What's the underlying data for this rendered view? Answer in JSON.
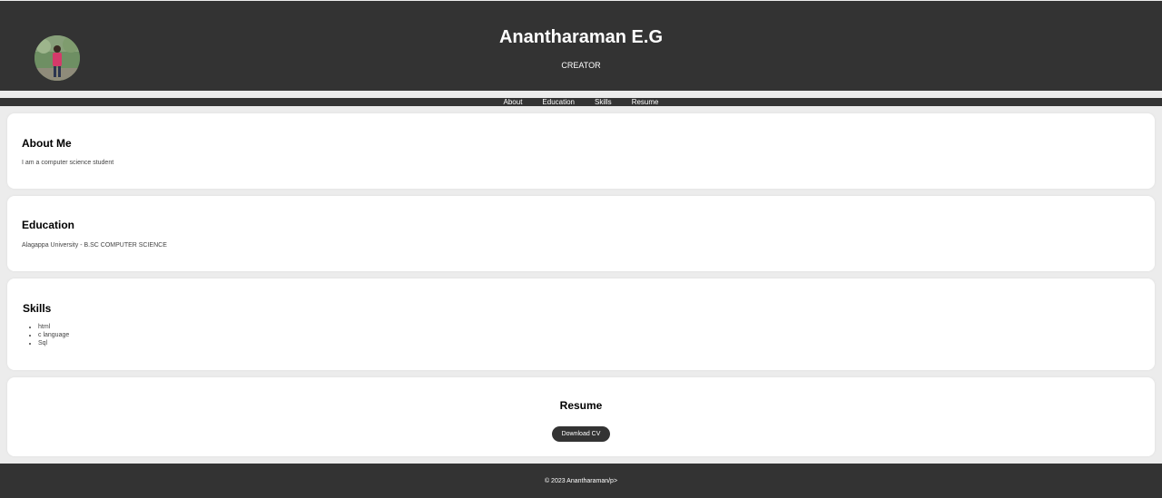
{
  "header": {
    "title": "Anantharaman E.G",
    "subtitle": "CREATOR"
  },
  "nav": {
    "items": [
      {
        "label": "About"
      },
      {
        "label": "Education"
      },
      {
        "label": "Skills"
      },
      {
        "label": "Resume"
      }
    ]
  },
  "about": {
    "heading": "About Me",
    "text": "I am a computer science student"
  },
  "education": {
    "heading": "Education",
    "text": "Alagappa University - B.SC COMPUTER SCIENCE"
  },
  "skills": {
    "heading": "Skills",
    "items": [
      "html",
      "c language",
      "Sql"
    ]
  },
  "resume": {
    "heading": "Resume",
    "button_label": "Download CV"
  },
  "footer": {
    "text": "© 2023 Anantharaman/p>"
  },
  "colors": {
    "header_bg": "#333333",
    "page_bg": "#ececec",
    "card_bg": "#ffffff",
    "button_bg": "#333333"
  }
}
